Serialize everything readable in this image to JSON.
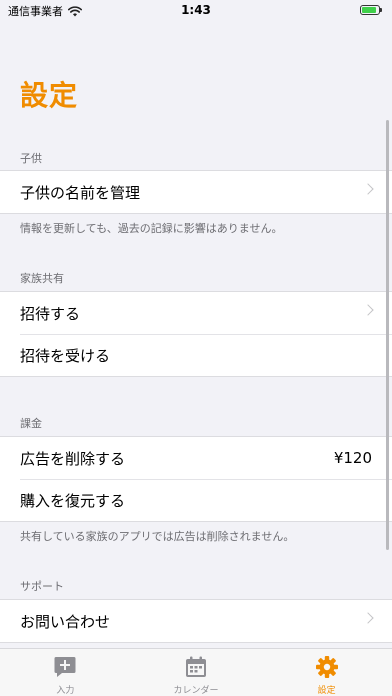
{
  "status_bar": {
    "carrier": "通信事業者",
    "time": "1:43"
  },
  "title": "設定",
  "sections": {
    "child": {
      "header": "子供",
      "items": [
        {
          "label": "子供の名前を管理"
        }
      ],
      "footer": "情報を更新しても、過去の記録に影響はありません。"
    },
    "family": {
      "header": "家族共有",
      "items": [
        {
          "label": "招待する"
        },
        {
          "label": "招待を受ける"
        }
      ]
    },
    "billing": {
      "header": "課金",
      "items": [
        {
          "label": "広告を削除する",
          "value": "¥120"
        },
        {
          "label": "購入を復元する"
        }
      ],
      "footer": "共有している家族のアプリでは広告は削除されません。"
    },
    "support": {
      "header": "サポート",
      "items": [
        {
          "label": "お問い合わせ"
        }
      ]
    }
  },
  "tab_bar": {
    "tabs": [
      {
        "label": "入力",
        "icon": "compose-icon"
      },
      {
        "label": "カレンダー",
        "icon": "calendar-icon"
      },
      {
        "label": "設定",
        "icon": "gear-icon"
      }
    ],
    "active_index": 2
  },
  "colors": {
    "accent": "#f08c00",
    "inactive_tab": "#8e8e93",
    "background": "#f2f2f7"
  }
}
